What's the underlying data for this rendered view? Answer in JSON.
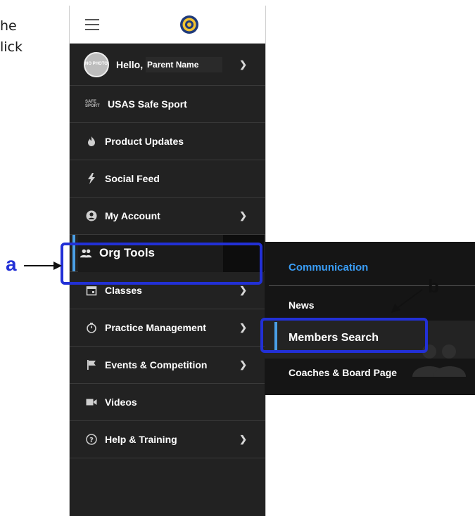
{
  "intro": {
    "line1": "he",
    "line2": "lick"
  },
  "sidebar": {
    "user": {
      "avatar_text": "NO PHOTO",
      "greeting": "Hello,",
      "name": "Parent Name"
    },
    "items": [
      {
        "label": "USAS Safe Sport",
        "icon": "safe-sport-logo",
        "has_chevron": false
      },
      {
        "label": "Product Updates",
        "icon": "flame-icon",
        "has_chevron": false
      },
      {
        "label": "Social Feed",
        "icon": "lightning-icon",
        "has_chevron": false
      },
      {
        "label": "My Account",
        "icon": "user-circle-icon",
        "has_chevron": true
      },
      {
        "label": "Org Tools",
        "icon": "people-icon",
        "has_chevron": false
      },
      {
        "label": "Classes",
        "icon": "calendar-icon",
        "has_chevron": true
      },
      {
        "label": "Practice Management",
        "icon": "stopwatch-icon",
        "has_chevron": true
      },
      {
        "label": "Events & Competition",
        "icon": "flag-icon",
        "has_chevron": true
      },
      {
        "label": "Videos",
        "icon": "video-camera-icon",
        "has_chevron": false
      },
      {
        "label": "Help & Training",
        "icon": "question-circle-icon",
        "has_chevron": true
      }
    ],
    "safe_sport_logo_text": "SAFE SPORT"
  },
  "submenu": {
    "heading": "Communication",
    "items": [
      "News",
      "Members Search",
      "Coaches & Board Page"
    ]
  },
  "annotations": {
    "a": "a",
    "b": "b"
  },
  "colors": {
    "sidebar_bg": "#222222",
    "accent_blue": "#3a9df5",
    "annotation_blue": "#2230d6"
  }
}
